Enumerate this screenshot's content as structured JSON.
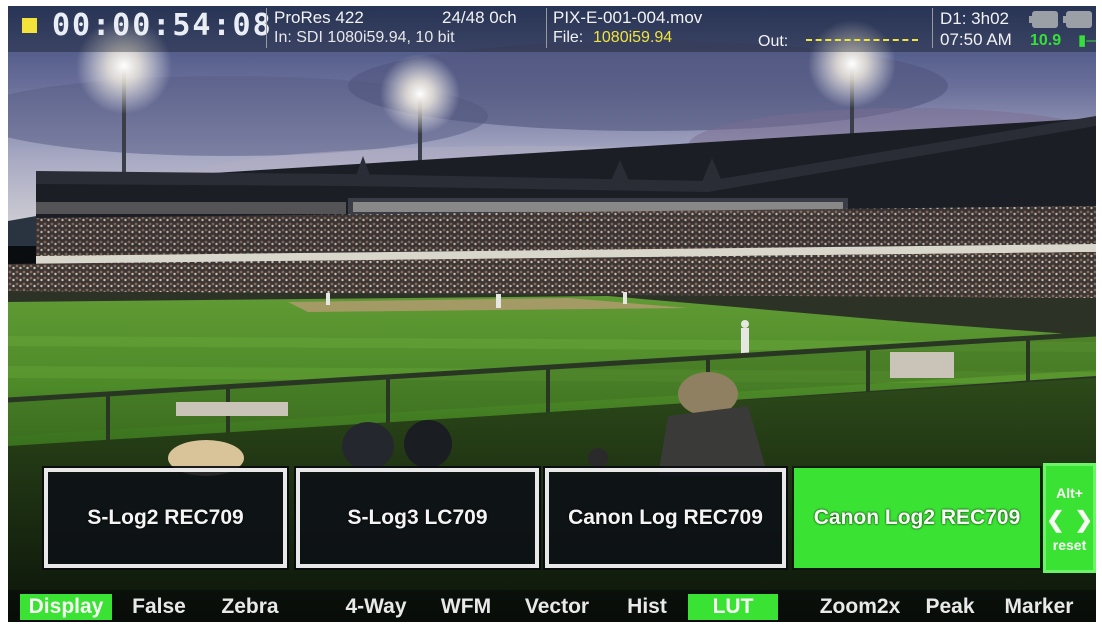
{
  "status_bar": {
    "timecode": "00:00:54:08",
    "codec": "ProRes 422",
    "channels": "24/48 0ch",
    "input_format": "In: SDI 1080i59.94, 10 bit",
    "filename": "PIX-E-001-004.mov",
    "file_label": "File:",
    "file_format": "1080i59.94",
    "out_label": "Out:",
    "disk_remaining": "D1: 3h02",
    "clock": "07:50 AM",
    "voltage": "10.9",
    "record_indicator_color": "#f2e23a",
    "battery_icons": [
      "battery-icon",
      "battery-icon"
    ],
    "plug_icon": "plug-icon"
  },
  "lut_options": {
    "buttons": [
      "S-Log2 REC709",
      "S-Log3 LC709",
      "Canon Log REC709",
      "Canon Log2 REC709"
    ],
    "selected_index": 3,
    "selected_color": "#3ae233",
    "alt_label": "Alt+",
    "prev_icon": "chevron-left-icon",
    "next_icon": "chevron-right-icon",
    "reset_label": "reset"
  },
  "menu": {
    "items": [
      "Display",
      "False",
      "Zebra",
      "4-Way",
      "WFM",
      "Vector",
      "Hist",
      "LUT",
      "Zoom2x",
      "Peak",
      "Marker"
    ],
    "active": [
      "Display",
      "LUT"
    ],
    "accent_color": "#3ae233"
  }
}
